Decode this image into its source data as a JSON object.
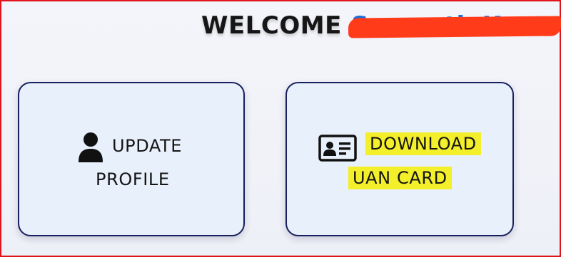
{
  "header": {
    "welcome_label": "WELCOME",
    "user_name": "Sumanth Kumar"
  },
  "cards": {
    "update_profile": {
      "line1": "UPDATE",
      "line2": "PROFILE",
      "icon": "person-icon"
    },
    "download_uan": {
      "line1": "DOWNLOAD",
      "line2": "UAN CARD",
      "icon": "id-card-icon",
      "highlight_color": "#f3ef2a"
    }
  },
  "colors": {
    "card_border": "#171f5e",
    "card_bg": "#e8f0fb",
    "frame_border": "#e0141c",
    "redaction": "#ff3b1a",
    "name_color": "#1a6fd8"
  }
}
